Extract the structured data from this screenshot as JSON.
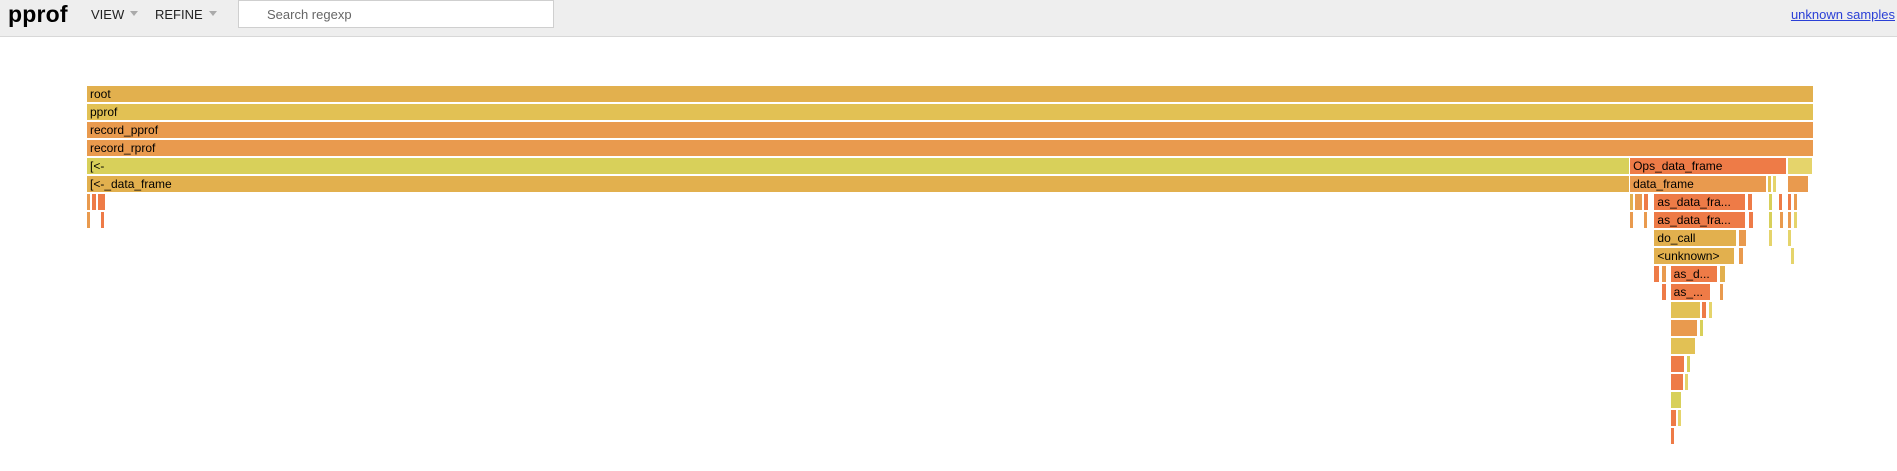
{
  "app": {
    "title": "pprof",
    "menus": [
      {
        "label": "VIEW"
      },
      {
        "label": "REFINE"
      }
    ],
    "search": {
      "placeholder": "Search regexp",
      "value": ""
    },
    "sample_link": "unknown samples"
  },
  "palette": {
    "yellow": "#e2c154",
    "gold": "#e2b04e",
    "orange": "#e99a4e",
    "deep_orange": "#ee7b47",
    "pale": "#d8d05a",
    "light_yellow": "#e5d46b"
  },
  "flamegraph": {
    "frames": [
      {
        "name": "root",
        "label": "root",
        "depth": 0,
        "start": 0.0,
        "width": 1.0,
        "color": "gold"
      },
      {
        "name": "pprof",
        "label": "pprof",
        "depth": 1,
        "start": 0.0,
        "width": 1.0,
        "color": "yellow"
      },
      {
        "name": "record_pprof",
        "label": "record_pprof",
        "depth": 2,
        "start": 0.0,
        "width": 1.0,
        "color": "orange"
      },
      {
        "name": "record_rprof",
        "label": "record_rprof",
        "depth": 3,
        "start": 0.0,
        "width": 1.0,
        "color": "orange"
      },
      {
        "name": "[<-",
        "label": "[<-",
        "depth": 4,
        "start": 0.0,
        "width": 0.8935,
        "color": "pale"
      },
      {
        "name": "Ops_data_frame",
        "label": "Ops_data_frame",
        "depth": 4,
        "start": 0.8935,
        "width": 0.0911,
        "color": "deep_orange"
      },
      {
        "name": "small-d4-a",
        "label": "",
        "depth": 4,
        "start": 0.9852,
        "width": 0.0143,
        "color": "light_yellow"
      },
      {
        "name": "[<-_data_frame",
        "label": "[<-_data_frame",
        "depth": 5,
        "start": 0.0,
        "width": 0.8935,
        "color": "gold"
      },
      {
        "name": "data_frame",
        "label": "data_frame",
        "depth": 5,
        "start": 0.8935,
        "width": 0.0791,
        "color": "orange"
      },
      {
        "name": "small-d5-a",
        "label": "",
        "depth": 5,
        "start": 0.9733,
        "width": 0.0022,
        "color": "yellow"
      },
      {
        "name": "small-d5-b",
        "label": "",
        "depth": 5,
        "start": 0.976,
        "width": 0.0016,
        "color": "light_yellow"
      },
      {
        "name": "small-d5-c",
        "label": "",
        "depth": 5,
        "start": 0.9852,
        "width": 0.0121,
        "color": "orange"
      },
      {
        "name": "small-d6-a",
        "label": "",
        "depth": 6,
        "start": 0.0,
        "width": 0.0016,
        "color": "orange"
      },
      {
        "name": "small-d6-b",
        "label": "",
        "depth": 6,
        "start": 0.003,
        "width": 0.003,
        "color": "deep_orange"
      },
      {
        "name": "small-d6-c",
        "label": "",
        "depth": 6,
        "start": 0.0065,
        "width": 0.0045,
        "color": "deep_orange"
      },
      {
        "name": "small-d6-d",
        "label": "",
        "depth": 6,
        "start": 0.8935,
        "width": 0.0022,
        "color": "gold"
      },
      {
        "name": "small-d6-e",
        "label": "",
        "depth": 6,
        "start": 0.8965,
        "width": 0.0045,
        "color": "orange"
      },
      {
        "name": "small-d6-f",
        "label": "",
        "depth": 6,
        "start": 0.9015,
        "width": 0.003,
        "color": "deep_orange"
      },
      {
        "name": "as_data_frame",
        "label": "as_data_fra...",
        "depth": 6,
        "start": 0.9076,
        "width": 0.0532,
        "color": "deep_orange"
      },
      {
        "name": "small-d6-g",
        "label": "",
        "depth": 6,
        "start": 0.9615,
        "width": 0.003,
        "color": "deep_orange"
      },
      {
        "name": "small-d6-h",
        "label": "",
        "depth": 6,
        "start": 0.974,
        "width": 0.0012,
        "color": "pale"
      },
      {
        "name": "small-d6-i",
        "label": "",
        "depth": 6,
        "start": 0.9796,
        "width": 0.0016,
        "color": "deep_orange"
      },
      {
        "name": "small-d6-j",
        "label": "",
        "depth": 6,
        "start": 0.9852,
        "width": 0.0022,
        "color": "deep_orange"
      },
      {
        "name": "small-d6-k",
        "label": "",
        "depth": 6,
        "start": 0.9885,
        "width": 0.0016,
        "color": "orange"
      },
      {
        "name": "small-d7-a",
        "label": "",
        "depth": 7,
        "start": 0.0,
        "width": 0.0012,
        "color": "orange"
      },
      {
        "name": "small-d7-b",
        "label": "",
        "depth": 7,
        "start": 0.0083,
        "width": 0.0016,
        "color": "deep_orange"
      },
      {
        "name": "small-d7-c",
        "label": "",
        "depth": 7,
        "start": 0.8935,
        "width": 0.0016,
        "color": "orange"
      },
      {
        "name": "small-d7-d",
        "label": "",
        "depth": 7,
        "start": 0.9015,
        "width": 0.0022,
        "color": "orange"
      },
      {
        "name": "as_data_frame_2",
        "label": "as_data_fra...",
        "depth": 7,
        "start": 0.9076,
        "width": 0.0532,
        "color": "deep_orange"
      },
      {
        "name": "small-d7-e",
        "label": "",
        "depth": 7,
        "start": 0.9622,
        "width": 0.003,
        "color": "deep_orange"
      },
      {
        "name": "small-d7-f",
        "label": "",
        "depth": 7,
        "start": 0.974,
        "width": 0.0012,
        "color": "pale"
      },
      {
        "name": "small-d7-g",
        "label": "",
        "depth": 7,
        "start": 0.9803,
        "width": 0.0012,
        "color": "orange"
      },
      {
        "name": "small-d7-h",
        "label": "",
        "depth": 7,
        "start": 0.9852,
        "width": 0.0022,
        "color": "orange"
      },
      {
        "name": "small-d7-i",
        "label": "",
        "depth": 7,
        "start": 0.9885,
        "width": 0.0012,
        "color": "light_yellow"
      },
      {
        "name": "do_call",
        "label": "do_call",
        "depth": 8,
        "start": 0.9076,
        "width": 0.048,
        "color": "gold"
      },
      {
        "name": "small-d8-a",
        "label": "",
        "depth": 8,
        "start": 0.9563,
        "width": 0.0052,
        "color": "orange"
      },
      {
        "name": "small-d8-b",
        "label": "",
        "depth": 8,
        "start": 0.974,
        "width": 0.0012,
        "color": "light_yellow"
      },
      {
        "name": "small-d8-c",
        "label": "",
        "depth": 8,
        "start": 0.9852,
        "width": 0.0012,
        "color": "light_yellow"
      },
      {
        "name": "<unknown>",
        "label": "<unknown>",
        "depth": 9,
        "start": 0.9076,
        "width": 0.0465,
        "color": "gold"
      },
      {
        "name": "small-d9-a",
        "label": "",
        "depth": 9,
        "start": 0.9563,
        "width": 0.003,
        "color": "orange"
      },
      {
        "name": "small-d9-b",
        "label": "",
        "depth": 9,
        "start": 0.9867,
        "width": 0.0012,
        "color": "light_yellow"
      },
      {
        "name": "small-d10-a",
        "label": "",
        "depth": 10,
        "start": 0.9076,
        "width": 0.003,
        "color": "deep_orange"
      },
      {
        "name": "small-d10-b",
        "label": "",
        "depth": 10,
        "start": 0.912,
        "width": 0.003,
        "color": "orange"
      },
      {
        "name": "as_d",
        "label": "as_d...",
        "depth": 10,
        "start": 0.917,
        "width": 0.0277,
        "color": "deep_orange"
      },
      {
        "name": "small-d10-c",
        "label": "",
        "depth": 10,
        "start": 0.9458,
        "width": 0.003,
        "color": "gold"
      },
      {
        "name": "small-d11-a",
        "label": "",
        "depth": 11,
        "start": 0.912,
        "width": 0.003,
        "color": "deep_orange"
      },
      {
        "name": "as_",
        "label": "as_...",
        "depth": 11,
        "start": 0.917,
        "width": 0.0232,
        "color": "deep_orange"
      },
      {
        "name": "small-d11-b",
        "label": "",
        "depth": 11,
        "start": 0.9458,
        "width": 0.0022,
        "color": "orange"
      },
      {
        "name": "small-d12-a",
        "label": "",
        "depth": 12,
        "start": 0.917,
        "width": 0.0175,
        "color": "yellow"
      },
      {
        "name": "small-d12-b",
        "label": "",
        "depth": 12,
        "start": 0.9353,
        "width": 0.003,
        "color": "deep_orange"
      },
      {
        "name": "small-d12-c",
        "label": "",
        "depth": 12,
        "start": 0.939,
        "width": 0.0012,
        "color": "light_yellow"
      },
      {
        "name": "small-d13-a",
        "label": "",
        "depth": 13,
        "start": 0.917,
        "width": 0.016,
        "color": "orange"
      },
      {
        "name": "small-d13-b",
        "label": "",
        "depth": 13,
        "start": 0.9338,
        "width": 0.0012,
        "color": "pale"
      },
      {
        "name": "small-d14-a",
        "label": "",
        "depth": 14,
        "start": 0.917,
        "width": 0.0145,
        "color": "yellow"
      },
      {
        "name": "small-d15-a",
        "label": "",
        "depth": 15,
        "start": 0.917,
        "width": 0.0084,
        "color": "deep_orange"
      },
      {
        "name": "small-d15-b",
        "label": "",
        "depth": 15,
        "start": 0.9262,
        "width": 0.0022,
        "color": "pale"
      },
      {
        "name": "small-d16-a",
        "label": "",
        "depth": 16,
        "start": 0.917,
        "width": 0.0076,
        "color": "deep_orange"
      },
      {
        "name": "small-d16-b",
        "label": "",
        "depth": 16,
        "start": 0.9254,
        "width": 0.0012,
        "color": "light_yellow"
      },
      {
        "name": "small-d17-a",
        "label": "",
        "depth": 17,
        "start": 0.917,
        "width": 0.0068,
        "color": "pale"
      },
      {
        "name": "small-d18-a",
        "label": "",
        "depth": 18,
        "start": 0.917,
        "width": 0.0038,
        "color": "deep_orange"
      },
      {
        "name": "small-d18-b",
        "label": "",
        "depth": 18,
        "start": 0.9214,
        "width": 0.0012,
        "color": "light_yellow"
      },
      {
        "name": "small-d19-a",
        "label": "",
        "depth": 19,
        "start": 0.917,
        "width": 0.0012,
        "color": "deep_orange"
      }
    ]
  }
}
